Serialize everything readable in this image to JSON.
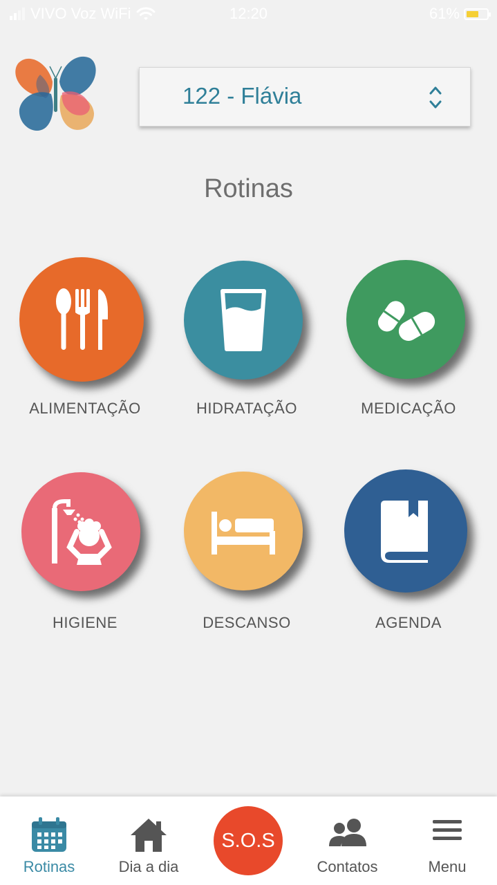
{
  "status_bar": {
    "carrier": "VIVO Voz WiFi",
    "time": "12:20",
    "battery": "61%",
    "battery_level": 0.61
  },
  "patient_selector": {
    "value": "122 - Flávia"
  },
  "page_title": "Rotinas",
  "routines": [
    {
      "label": "ALIMENTAÇÃO",
      "icon": "utensils-icon",
      "color": "#e76a2a"
    },
    {
      "label": "HIDRATAÇÃO",
      "icon": "glass-of-water-icon",
      "color": "#3b8ea0"
    },
    {
      "label": "MEDICAÇÃO",
      "icon": "pills-icon",
      "color": "#3f9a5f"
    },
    {
      "label": "HIGIENE",
      "icon": "shower-icon",
      "color": "#e96a77"
    },
    {
      "label": "DESCANSO",
      "icon": "bed-icon",
      "color": "#f2b866"
    },
    {
      "label": "AGENDA",
      "icon": "book-icon",
      "color": "#2f5f93"
    }
  ],
  "bottom_nav": {
    "items": [
      {
        "label": "Rotinas",
        "icon": "calendar-icon",
        "active": true
      },
      {
        "label": "Dia a dia",
        "icon": "home-icon",
        "active": false
      },
      {
        "label": "Contatos",
        "icon": "contacts-icon",
        "active": false
      },
      {
        "label": "Menu",
        "icon": "hamburger-menu-icon",
        "active": false
      }
    ],
    "sos_label": "S.O.S",
    "sos_color": "#e8492b",
    "active_color": "#3a8aa5"
  }
}
